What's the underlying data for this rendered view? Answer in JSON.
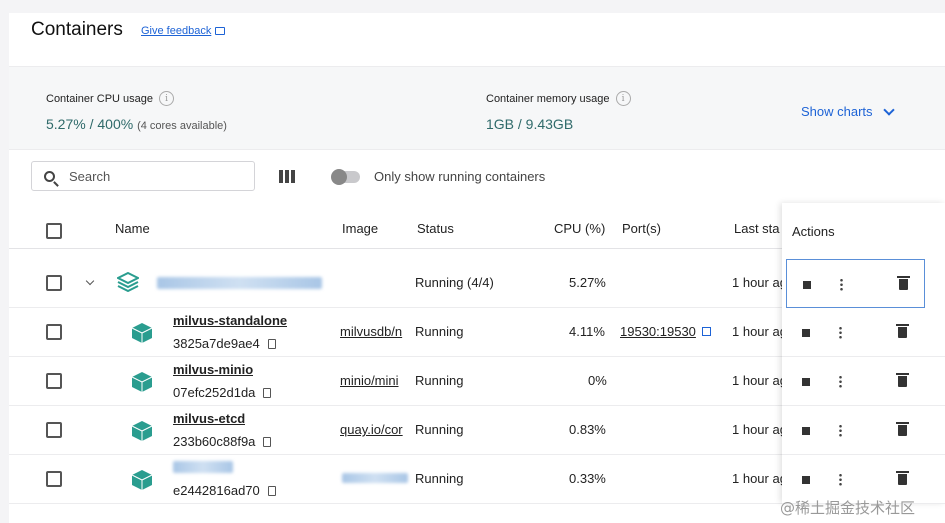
{
  "header": {
    "title": "Containers",
    "feedback_label": "Give feedback"
  },
  "stats": {
    "cpu_label": "Container CPU usage",
    "cpu_value": "5.27% / 400%",
    "cpu_note": "(4 cores available)",
    "memory_label": "Container memory usage",
    "memory_value": "1GB / 9.43GB",
    "show_charts_label": "Show charts"
  },
  "toolbar": {
    "search_placeholder": "Search",
    "toggle_label": "Only show running containers"
  },
  "table": {
    "columns": {
      "name": "Name",
      "image": "Image",
      "status": "Status",
      "cpu": "CPU (%)",
      "ports": "Port(s)",
      "last_started": "Last sta",
      "actions": "Actions"
    },
    "group": {
      "status": "Running (4/4)",
      "cpu": "5.27%",
      "last_started": "1 hour ag"
    },
    "rows": [
      {
        "name": "milvus-standalone",
        "id": "3825a7de9ae4",
        "image": "milvusdb/n",
        "status": "Running",
        "cpu": "4.11%",
        "ports": "19530:19530",
        "last_started": "1 hour ag"
      },
      {
        "name": "milvus-minio",
        "id": "07efc252d1da",
        "image": "minio/mini",
        "status": "Running",
        "cpu": "0%",
        "ports": "",
        "last_started": "1 hour ag"
      },
      {
        "name": "milvus-etcd",
        "id": "233b60c88f9a",
        "image": "quay.io/cor",
        "status": "Running",
        "cpu": "0.83%",
        "ports": "",
        "last_started": "1 hour ag"
      },
      {
        "name": "",
        "id": "e2442816ad70",
        "image": "",
        "status": "Running",
        "cpu": "0.33%",
        "ports": "",
        "last_started": "1 hour ag"
      }
    ]
  },
  "colors": {
    "accent": "#1d63d6",
    "stat_value": "#2f6a6a",
    "container_icon": "#2a9d8f"
  },
  "watermark": "@稀土掘金技术社区"
}
